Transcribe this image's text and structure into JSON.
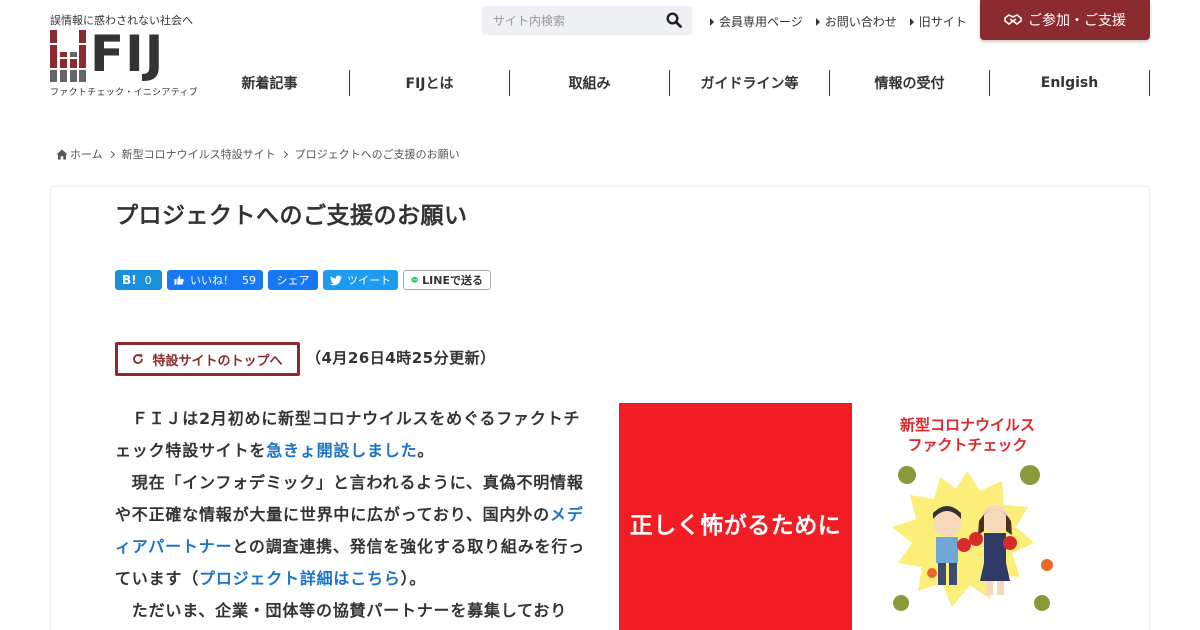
{
  "header": {
    "tagline": "誤情報に惑わされない社会へ",
    "logo_text": "FIJ",
    "logo_sub": "ファクトチェック・イニシアティブ",
    "search_placeholder": "サイト内検索",
    "util_links": [
      "会員専用ページ",
      "お問い合わせ",
      "旧サイト"
    ],
    "join_label": "ご参加・ご支援",
    "nav": [
      "新着記事",
      "FIJとは",
      "取組み",
      "ガイドライン等",
      "情報の受付",
      "Enlgish"
    ]
  },
  "breadcrumb": [
    "ホーム",
    "新型コロナウイルス特設サイト",
    "プロジェクトへのご支援のお願い"
  ],
  "page": {
    "title": "プロジェクトへのご支援のお願い",
    "share": {
      "hatena_count": "0",
      "like_label": "いいね！",
      "like_count": "59",
      "share_label": "シェア",
      "tweet_label": "ツイート",
      "line_label": "LINEで送る"
    },
    "top_button": "特設サイトのトップへ",
    "update_note": "（4月26日4時25分更新）",
    "p1_a": "　ＦＩＪは2月初めに新型コロナウイルスをめぐるファクトチェック特設サイトを",
    "p1_link": "急きょ開設しました",
    "p1_b": "。",
    "p2_a": "　現在「インフォデミック」と言われるように、真偽不明情報や不正確な情報が大量に世界中に広がっており、国内外の",
    "p2_link1": "メディアパートナー",
    "p2_b": "との調査連携、発信を強化する取り組みを行っています（",
    "p2_link2": "プロジェクト詳細はこちら",
    "p2_c": "）。",
    "p3": "　ただいま、企業・団体等の協賛パートナーを募集しており",
    "hero_left": "正しく怖がるために",
    "hero_title_1": "新型コロナウイルス",
    "hero_title_2": "ファクトチェック"
  },
  "colors": {
    "brand": "#8b2a2f",
    "link": "#1a73c8",
    "hero_red": "#f21c24"
  }
}
